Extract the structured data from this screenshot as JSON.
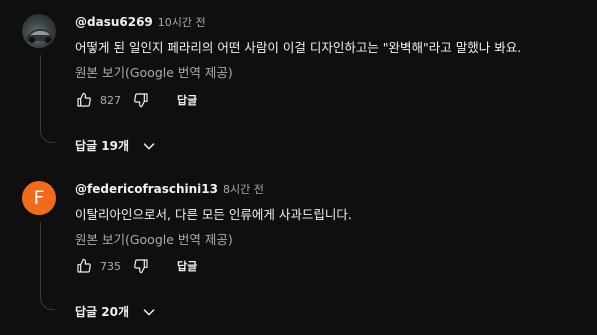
{
  "comments": [
    {
      "author": "@dasu6269",
      "time": "10시간 전",
      "avatar_type": "photo",
      "text": "어떻게 된 일인지 페라리의 어떤 사람이 이걸 디자인하고는 \"완벽해\"라고 말했나 봐요.",
      "translate_label": "원본 보기(Google 번역 제공)",
      "likes": "827",
      "reply_label": "답글",
      "replies_label": "답글 19개"
    },
    {
      "author": "@federicofraschini13",
      "time": "8시간 전",
      "avatar_type": "letter",
      "avatar_letter": "F",
      "avatar_color": "#f26b1d",
      "text": "이탈리아인으로서, 다른 모든 인류에게 사과드립니다.",
      "translate_label": "원본 보기(Google 번역 제공)",
      "likes": "735",
      "reply_label": "답글",
      "replies_label": "답글 20개"
    }
  ],
  "icons": {
    "like": "thumbs-up-icon",
    "dislike": "thumbs-down-icon",
    "expand": "chevron-down-icon"
  },
  "colors": {
    "background": "#0f0f0f",
    "primary_text": "#f1f1f1",
    "secondary_text": "#aaaaaa"
  }
}
